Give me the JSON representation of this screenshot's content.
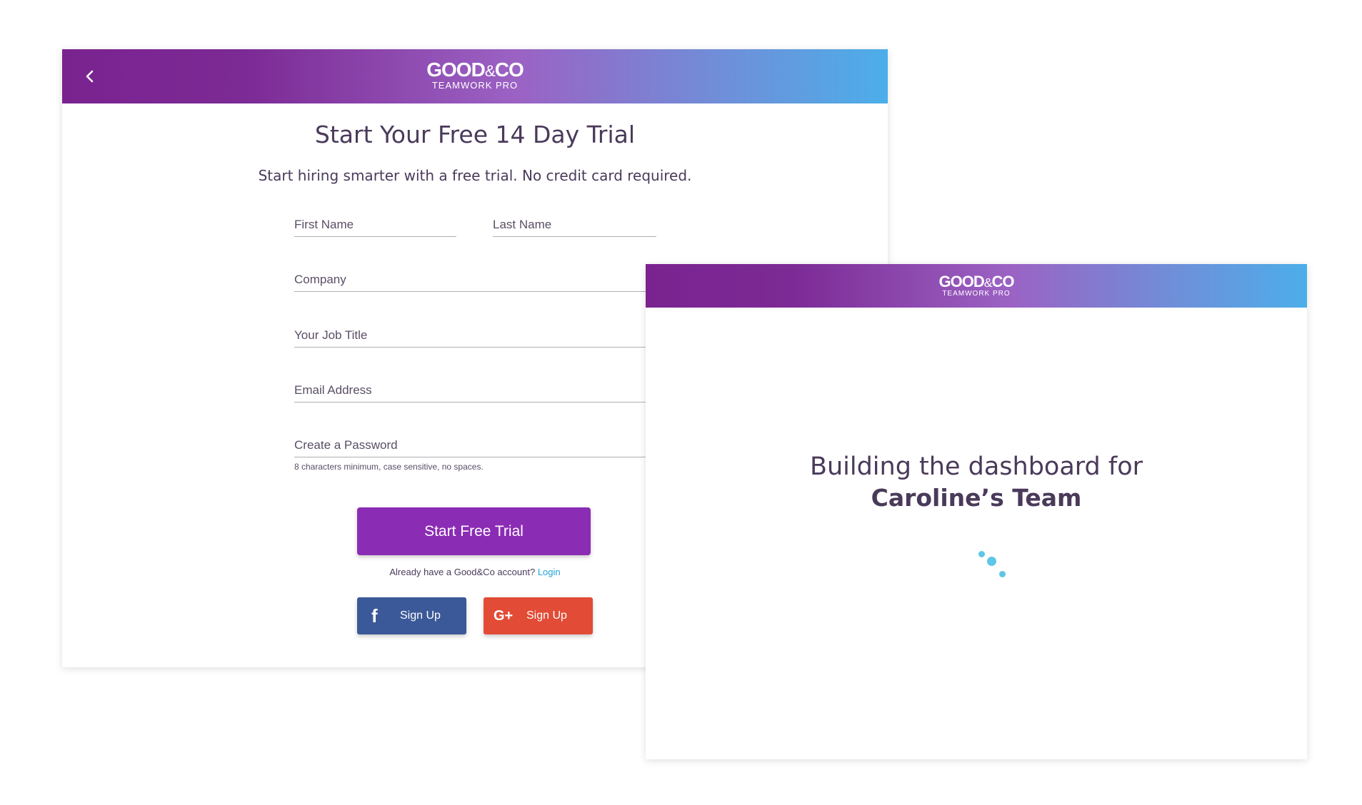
{
  "signup": {
    "logo": {
      "main_left": "GOOD",
      "amp": "&",
      "main_right": "CO",
      "sub": "TEAMWORK PRO"
    },
    "title": "Start Your Free 14 Day Trial",
    "subtitle": "Start hiring smarter with a free trial. No credit card required.",
    "fields": {
      "first_name": "First Name",
      "last_name": "Last Name",
      "company": "Company",
      "job_title": "Your Job Title",
      "email": "Email Address",
      "password": "Create a Password"
    },
    "password_hint": "8 characters minimum, case sensitive, no spaces.",
    "submit_label": "Start Free Trial",
    "login_prompt": "Already have a Good&Co account?",
    "login_link": "Login",
    "facebook": {
      "icon": "f",
      "label": "Sign Up"
    },
    "google": {
      "icon": "G+",
      "label": "Sign Up"
    }
  },
  "loading": {
    "logo": {
      "main_left": "GOOD",
      "amp": "&",
      "main_right": "CO",
      "sub": "TEAMWORK PRO"
    },
    "line1": "Building the dashboard for",
    "team_name": "Caroline’s Team"
  },
  "colors": {
    "brand_purple": "#8b2cb5",
    "header_gradient_start": "#7a2390",
    "header_gradient_end": "#4caee9",
    "facebook_blue": "#3b5998",
    "google_red": "#e24b35",
    "link_blue": "#1fa3d8",
    "spinner_blue": "#5ec6e6"
  }
}
